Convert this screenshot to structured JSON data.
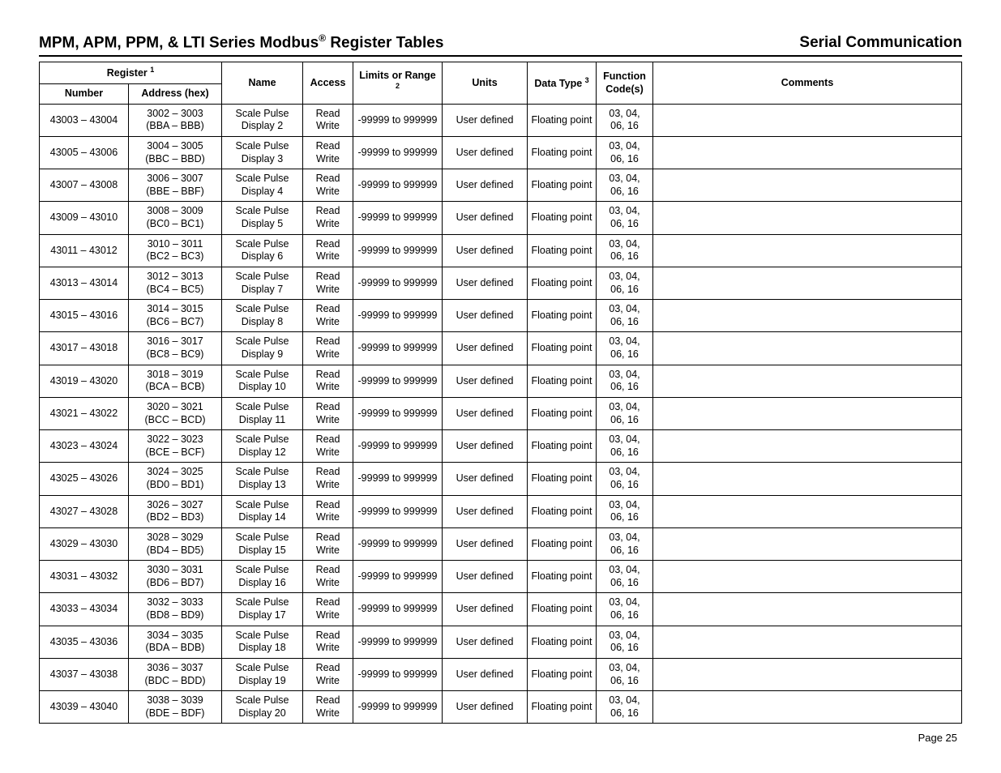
{
  "header": {
    "title_prefix": "MPM, APM, PPM, & LTI Series Modbus",
    "title_reg": "®",
    "title_suffix": " Register Tables",
    "right": "Serial Communication"
  },
  "columns": {
    "register_group": "Register ",
    "register_sup": "1",
    "number": "Number",
    "address": "Address (hex)",
    "name": "Name",
    "access": "Access",
    "limits": "Limits or Range ",
    "limits_sup": "2",
    "units": "Units",
    "data_type": "Data Type ",
    "data_type_sup": "3",
    "func": "Function Code(s)",
    "comments": "Comments"
  },
  "rows": [
    {
      "number": "43003 – 43004",
      "address_l1": "3002 – 3003",
      "address_l2": "(BBA – BBB)",
      "name_l1": "Scale Pulse",
      "name_l2": "Display 2",
      "access": "Read Write",
      "limits": "-99999 to 999999",
      "units": "User defined",
      "dtype": "Floating point",
      "fc_l1": "03, 04,",
      "fc_l2": "06, 16",
      "comments": ""
    },
    {
      "number": "43005 – 43006",
      "address_l1": "3004 – 3005",
      "address_l2": "(BBC – BBD)",
      "name_l1": "Scale Pulse",
      "name_l2": "Display 3",
      "access": "Read Write",
      "limits": "-99999 to 999999",
      "units": "User defined",
      "dtype": "Floating point",
      "fc_l1": "03, 04,",
      "fc_l2": "06, 16",
      "comments": ""
    },
    {
      "number": "43007 – 43008",
      "address_l1": "3006 – 3007",
      "address_l2": "(BBE – BBF)",
      "name_l1": "Scale Pulse",
      "name_l2": "Display 4",
      "access": "Read Write",
      "limits": "-99999 to 999999",
      "units": "User defined",
      "dtype": "Floating point",
      "fc_l1": "03, 04,",
      "fc_l2": "06, 16",
      "comments": ""
    },
    {
      "number": "43009 – 43010",
      "address_l1": "3008 – 3009",
      "address_l2": "(BC0 – BC1)",
      "name_l1": "Scale Pulse",
      "name_l2": "Display 5",
      "access": "Read Write",
      "limits": "-99999 to 999999",
      "units": "User defined",
      "dtype": "Floating point",
      "fc_l1": "03, 04,",
      "fc_l2": "06, 16",
      "comments": ""
    },
    {
      "number": "43011 – 43012",
      "address_l1": "3010 – 3011",
      "address_l2": "(BC2 – BC3)",
      "name_l1": "Scale Pulse",
      "name_l2": "Display 6",
      "access": "Read Write",
      "limits": "-99999 to 999999",
      "units": "User defined",
      "dtype": "Floating point",
      "fc_l1": "03, 04,",
      "fc_l2": "06, 16",
      "comments": ""
    },
    {
      "number": "43013 – 43014",
      "address_l1": "3012 – 3013",
      "address_l2": "(BC4 – BC5)",
      "name_l1": "Scale Pulse",
      "name_l2": "Display 7",
      "access": "Read Write",
      "limits": "-99999 to 999999",
      "units": "User defined",
      "dtype": "Floating point",
      "fc_l1": "03, 04,",
      "fc_l2": "06, 16",
      "comments": ""
    },
    {
      "number": "43015 – 43016",
      "address_l1": "3014 – 3015",
      "address_l2": "(BC6 – BC7)",
      "name_l1": "Scale Pulse",
      "name_l2": "Display 8",
      "access": "Read Write",
      "limits": "-99999 to 999999",
      "units": "User defined",
      "dtype": "Floating point",
      "fc_l1": "03, 04,",
      "fc_l2": "06, 16",
      "comments": ""
    },
    {
      "number": "43017 – 43018",
      "address_l1": "3016 – 3017",
      "address_l2": "(BC8 – BC9)",
      "name_l1": "Scale Pulse",
      "name_l2": "Display 9",
      "access": "Read Write",
      "limits": "-99999 to 999999",
      "units": "User defined",
      "dtype": "Floating point",
      "fc_l1": "03, 04,",
      "fc_l2": "06, 16",
      "comments": ""
    },
    {
      "number": "43019 – 43020",
      "address_l1": "3018 – 3019",
      "address_l2": "(BCA – BCB)",
      "name_l1": "Scale Pulse",
      "name_l2": "Display 10",
      "access": "Read Write",
      "limits": "-99999 to 999999",
      "units": "User defined",
      "dtype": "Floating point",
      "fc_l1": "03, 04,",
      "fc_l2": "06, 16",
      "comments": ""
    },
    {
      "number": "43021 – 43022",
      "address_l1": "3020 – 3021",
      "address_l2": "(BCC – BCD)",
      "name_l1": "Scale Pulse",
      "name_l2": "Display 11",
      "access": "Read Write",
      "limits": "-99999 to 999999",
      "units": "User defined",
      "dtype": "Floating point",
      "fc_l1": "03, 04,",
      "fc_l2": "06, 16",
      "comments": ""
    },
    {
      "number": "43023 – 43024",
      "address_l1": "3022 – 3023",
      "address_l2": "(BCE – BCF)",
      "name_l1": "Scale Pulse",
      "name_l2": "Display 12",
      "access": "Read Write",
      "limits": "-99999 to 999999",
      "units": "User defined",
      "dtype": "Floating point",
      "fc_l1": "03, 04,",
      "fc_l2": "06, 16",
      "comments": ""
    },
    {
      "number": "43025 – 43026",
      "address_l1": "3024 – 3025",
      "address_l2": "(BD0 – BD1)",
      "name_l1": "Scale Pulse",
      "name_l2": "Display 13",
      "access": "Read Write",
      "limits": "-99999 to 999999",
      "units": "User defined",
      "dtype": "Floating point",
      "fc_l1": "03, 04,",
      "fc_l2": "06, 16",
      "comments": ""
    },
    {
      "number": "43027 –  43028",
      "address_l1": "3026 – 3027",
      "address_l2": "(BD2 – BD3)",
      "name_l1": "Scale Pulse",
      "name_l2": "Display 14",
      "access": "Read Write",
      "limits": "-99999 to 999999",
      "units": "User defined",
      "dtype": "Floating point",
      "fc_l1": "03, 04,",
      "fc_l2": "06, 16",
      "comments": ""
    },
    {
      "number": "43029 – 43030",
      "address_l1": "3028 – 3029",
      "address_l2": "(BD4 – BD5)",
      "name_l1": "Scale Pulse",
      "name_l2": "Display 15",
      "access": "Read Write",
      "limits": "-99999 to 999999",
      "units": "User defined",
      "dtype": "Floating point",
      "fc_l1": "03, 04,",
      "fc_l2": "06, 16",
      "comments": ""
    },
    {
      "number": "43031 – 43032",
      "address_l1": "3030 – 3031",
      "address_l2": "(BD6 – BD7)",
      "name_l1": "Scale Pulse",
      "name_l2": "Display 16",
      "access": "Read Write",
      "limits": "-99999 to 999999",
      "units": "User defined",
      "dtype": "Floating point",
      "fc_l1": "03, 04,",
      "fc_l2": "06, 16",
      "comments": ""
    },
    {
      "number": "43033 – 43034",
      "address_l1": "3032 – 3033",
      "address_l2": "(BD8 – BD9)",
      "name_l1": "Scale Pulse",
      "name_l2": "Display 17",
      "access": "Read Write",
      "limits": "-99999 to 999999",
      "units": "User defined",
      "dtype": "Floating point",
      "fc_l1": "03, 04,",
      "fc_l2": "06, 16",
      "comments": ""
    },
    {
      "number": "43035 – 43036",
      "address_l1": "3034 – 3035",
      "address_l2": "(BDA – BDB)",
      "name_l1": "Scale Pulse",
      "name_l2": "Display 18",
      "access": "Read Write",
      "limits": "-99999 to 999999",
      "units": "User defined",
      "dtype": "Floating point",
      "fc_l1": "03, 04,",
      "fc_l2": "06, 16",
      "comments": ""
    },
    {
      "number": "43037 – 43038",
      "address_l1": "3036 – 3037",
      "address_l2": "(BDC – BDD)",
      "name_l1": "Scale Pulse",
      "name_l2": "Display 19",
      "access": "Read Write",
      "limits": "-99999 to 999999",
      "units": "User defined",
      "dtype": "Floating point",
      "fc_l1": "03, 04,",
      "fc_l2": "06, 16",
      "comments": ""
    },
    {
      "number": "43039 – 43040",
      "address_l1": "3038 – 3039",
      "address_l2": "(BDE – BDF)",
      "name_l1": "Scale Pulse",
      "name_l2": "Display 20",
      "access": "Read Write",
      "limits": "-99999 to 999999",
      "units": "User defined",
      "dtype": "Floating point",
      "fc_l1": "03, 04,",
      "fc_l2": "06, 16",
      "comments": ""
    }
  ],
  "footer": {
    "page": "Page 25"
  }
}
